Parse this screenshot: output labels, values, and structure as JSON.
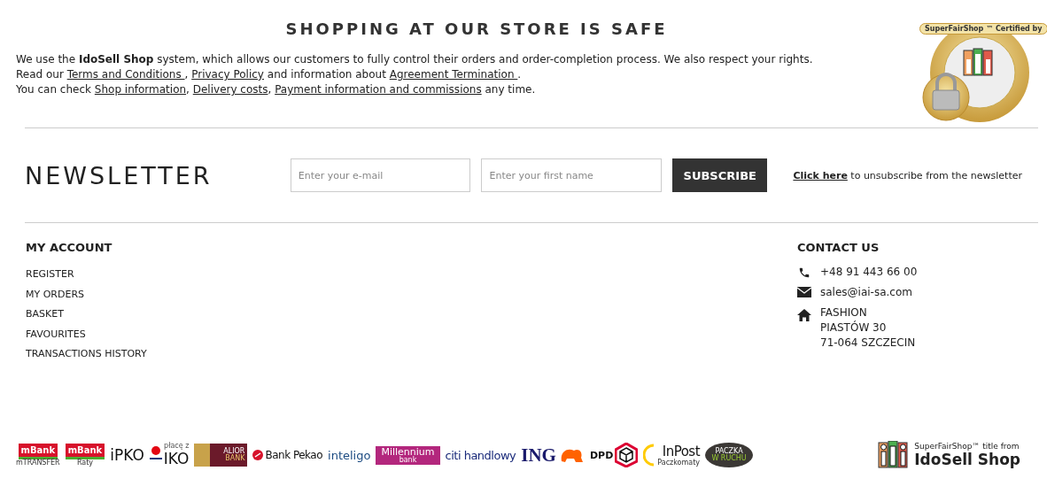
{
  "safety": {
    "title": "SHOPPING AT OUR STORE IS SAFE",
    "lines": [
      [
        {
          "kind": "text",
          "text": "We use the **IdoSell Shop** system, which allows our customers to fully control their orders and order-completion process. We also respect your rights."
        }
      ],
      [
        {
          "kind": "text",
          "text": "Read our "
        },
        {
          "kind": "link",
          "text": "Terms and Conditions "
        },
        {
          "kind": "text",
          "text": ", "
        },
        {
          "kind": "link",
          "text": "Privacy Policy"
        },
        {
          "kind": "text",
          "text": " and information about "
        },
        {
          "kind": "link",
          "text": "Agreement Termination "
        },
        {
          "kind": "text",
          "text": "."
        }
      ],
      [
        {
          "kind": "text",
          "text": "You can check "
        },
        {
          "kind": "link",
          "text": "Shop information"
        },
        {
          "kind": "text",
          "text": ", "
        },
        {
          "kind": "link",
          "text": "Delivery costs"
        },
        {
          "kind": "text",
          "text": ", "
        },
        {
          "kind": "link",
          "text": "Payment information and commissions"
        },
        {
          "kind": "text",
          "text": " any time."
        }
      ]
    ],
    "badge": {
      "text": "SuperFairShop ™ Certified by"
    }
  },
  "newsletter": {
    "title": "NEWSLETTER",
    "email": {
      "placeholder": "Enter your e-mail"
    },
    "name": {
      "placeholder": "Enter your first name"
    },
    "button": "SUBSCRIBE",
    "unsubscribe_link": "Click here",
    "unsubscribe_text": " to unsubscribe from the newsletter"
  },
  "account": {
    "title": "MY ACCOUNT",
    "items": [
      "REGISTER",
      "MY ORDERS",
      "BASKET",
      "FAVOURITES",
      "TRANSACTIONS HISTORY"
    ]
  },
  "contact": {
    "title": "CONTACT US",
    "items": [
      {
        "kind": "phone",
        "lines": [
          "+48 91 443 66 00"
        ]
      },
      {
        "kind": "email",
        "lines": [
          "sales@iai-sa.com"
        ]
      },
      {
        "kind": "address",
        "lines": [
          "FASHION",
          "PIASTÓW 30",
          "71-064 SZCZECIN"
        ]
      }
    ]
  },
  "payment_logos": [
    {
      "kind": "mbank",
      "text": "mBank",
      "subtext": "mTRANSFER"
    },
    {
      "kind": "mbank",
      "text": "mBank",
      "subtext": "Raty"
    },
    {
      "kind": "ipko",
      "text": "iPKO"
    },
    {
      "kind": "iko",
      "text": "IKO",
      "subtext": "płacę z"
    },
    {
      "kind": "alior",
      "text": "ALIOR",
      "subtext": "BANK"
    },
    {
      "kind": "pekao",
      "text": "Bank Pekao"
    },
    {
      "kind": "inteligo",
      "text": "inteligo"
    },
    {
      "kind": "millennium",
      "text": "Millennium",
      "subtext": "bank"
    },
    {
      "kind": "citi",
      "text": "citi handlowy"
    },
    {
      "kind": "ing",
      "text": "ING"
    },
    {
      "kind": "dpd",
      "text": "DPD"
    },
    {
      "kind": "inpost",
      "text": "InPost",
      "subtext": "Paczkomaty"
    },
    {
      "kind": "ruch",
      "text": "PACZKA",
      "subtext": "W RUCHU"
    }
  ],
  "certificate": {
    "line1": "SuperFairShop™ title from",
    "line2": "IdoSell Shop"
  }
}
